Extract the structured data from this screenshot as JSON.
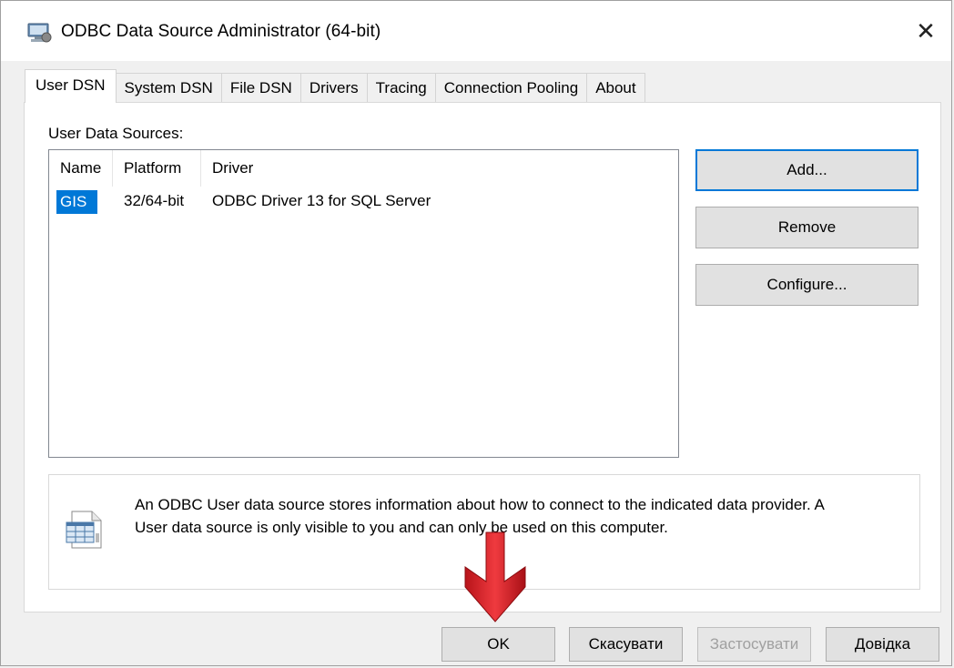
{
  "window": {
    "title": "ODBC Data Source Administrator (64-bit)",
    "close_glyph": "✕"
  },
  "tabs": [
    {
      "label": "User DSN",
      "active": true
    },
    {
      "label": "System DSN"
    },
    {
      "label": "File DSN"
    },
    {
      "label": "Drivers"
    },
    {
      "label": "Tracing"
    },
    {
      "label": "Connection Pooling"
    },
    {
      "label": "About"
    }
  ],
  "sources": {
    "label": "User Data Sources:",
    "columns": [
      "Name",
      "Platform",
      "Driver"
    ],
    "rows": [
      {
        "name": "GIS",
        "platform": "32/64-bit",
        "driver": "ODBC Driver 13 for SQL Server",
        "selected": true
      }
    ]
  },
  "actions": {
    "add": "Add...",
    "remove": "Remove",
    "configure": "Configure..."
  },
  "info": {
    "line1": "An ODBC User data source stores information about how to connect to the indicated data provider.   A",
    "line2": "User data source is only visible to you and can only be used on this computer."
  },
  "footer": {
    "ok": "OK",
    "cancel": "Скасувати",
    "apply": "Застосувати",
    "help": "Довідка"
  },
  "colors": {
    "selection": "#0078d7",
    "annotation_arrow": "#e0252b"
  }
}
